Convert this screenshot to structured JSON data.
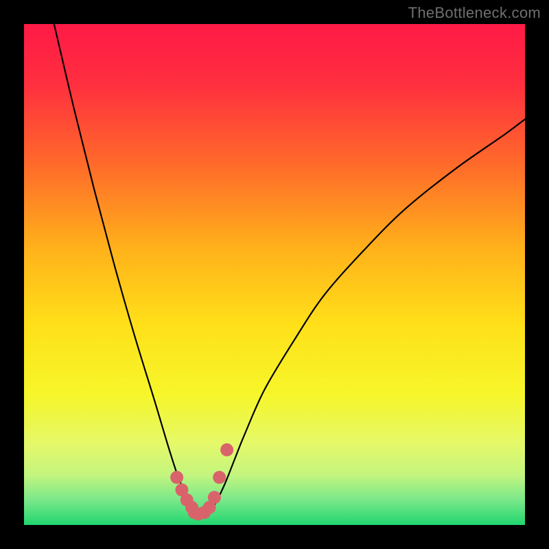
{
  "watermark": "TheBottleneck.com",
  "chart_data": {
    "type": "line",
    "title": "",
    "xlabel": "",
    "ylabel": "",
    "xlim": [
      0,
      100
    ],
    "ylim": [
      0,
      100
    ],
    "gradient": {
      "description": "vertical rainbow gradient, red at top through orange/yellow to green at bottom",
      "stops": [
        {
          "offset": 0.0,
          "color": "#ff1a46"
        },
        {
          "offset": 0.12,
          "color": "#ff2f3f"
        },
        {
          "offset": 0.28,
          "color": "#ff6a2a"
        },
        {
          "offset": 0.45,
          "color": "#ffb21a"
        },
        {
          "offset": 0.6,
          "color": "#ffe019"
        },
        {
          "offset": 0.74,
          "color": "#f6f62a"
        },
        {
          "offset": 0.84,
          "color": "#e4f86a"
        },
        {
          "offset": 0.9,
          "color": "#c3f57e"
        },
        {
          "offset": 0.95,
          "color": "#7ae88a"
        },
        {
          "offset": 1.0,
          "color": "#21d66f"
        }
      ]
    },
    "series": [
      {
        "name": "bottleneck-curve",
        "note": "V-shaped curve; y is percent-from-top (0=top, 100=bottom). Values estimated from pixels.",
        "x": [
          6,
          10,
          14,
          18,
          22,
          26,
          29,
          31,
          33,
          34.5,
          36,
          38,
          40,
          42,
          44,
          48,
          54,
          60,
          68,
          76,
          86,
          96,
          100
        ],
        "y": [
          0,
          17,
          33,
          48,
          62,
          75,
          85,
          91,
          95,
          97.5,
          98,
          96,
          92,
          87,
          82,
          73,
          63,
          54,
          45,
          37,
          29,
          22,
          19
        ]
      },
      {
        "name": "highlight-dots",
        "note": "pink-red thick dots near the valley floor",
        "color": "#d9636a",
        "x": [
          30.5,
          31.5,
          32.5,
          33.5,
          34.0,
          34.8,
          36.0,
          37.0,
          38.0,
          39.0,
          40.5
        ],
        "y": [
          90.5,
          93.0,
          95.0,
          96.5,
          97.5,
          97.8,
          97.5,
          96.5,
          94.5,
          90.5,
          85.0
        ]
      }
    ]
  }
}
